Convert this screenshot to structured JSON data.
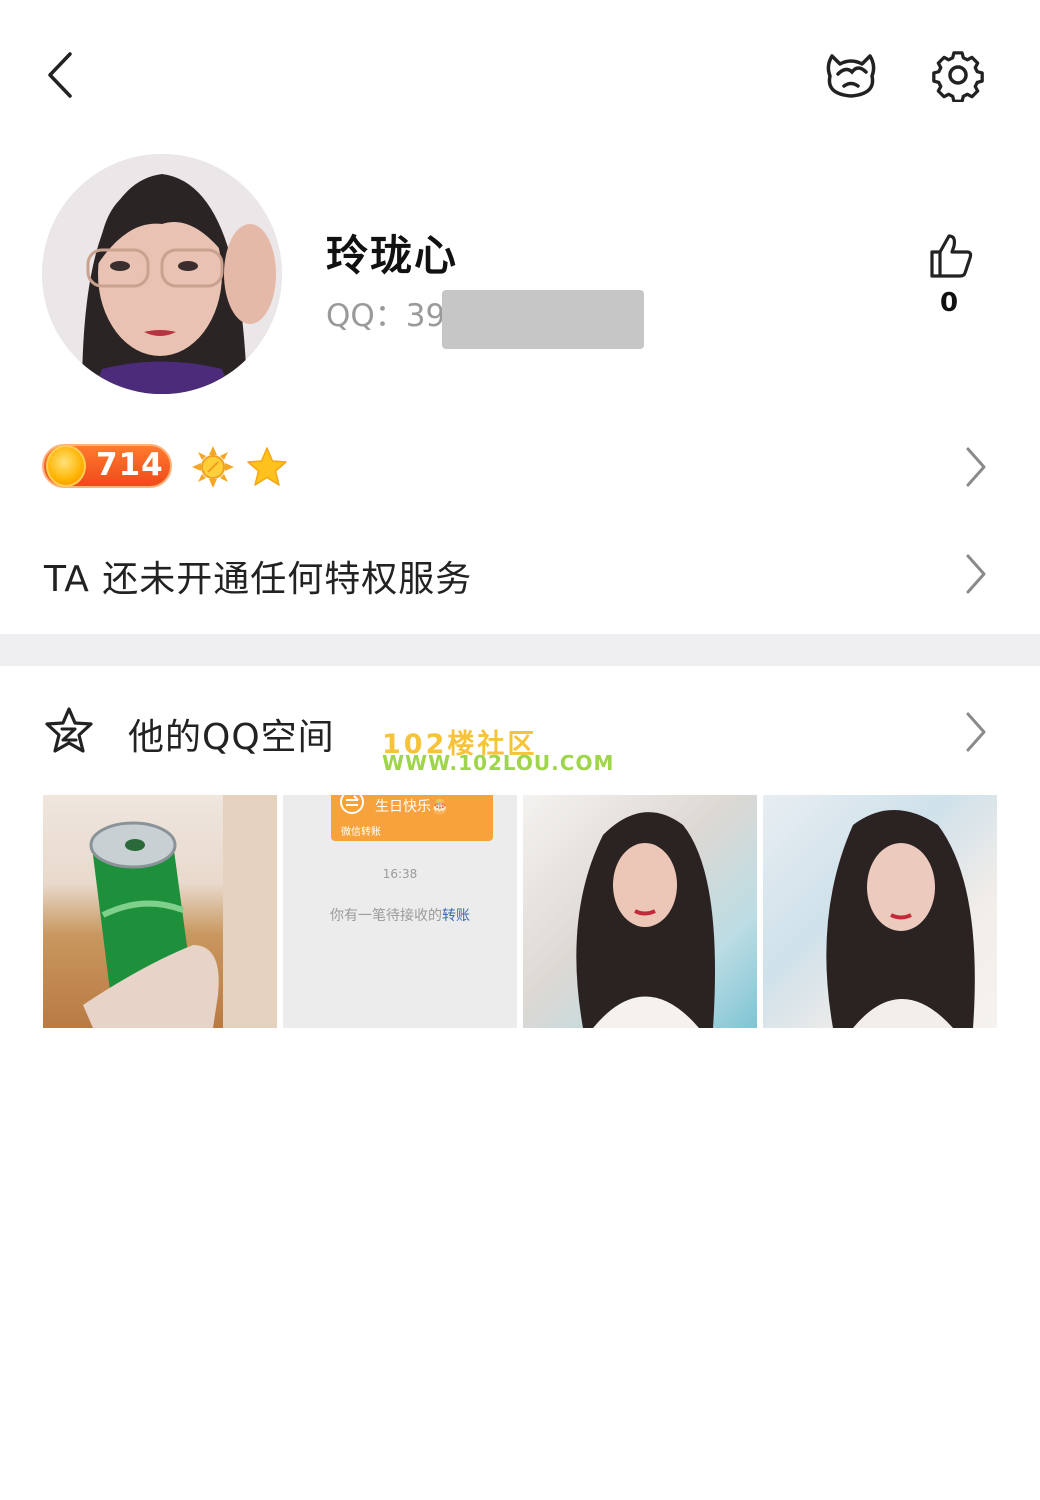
{
  "topbar": {
    "back_icon": "chevron-left-icon",
    "pet_icon": "pet-cat-icon",
    "settings_icon": "gear-icon"
  },
  "profile": {
    "nickname": "玲珑心",
    "qq_label": "QQ：39",
    "likes": "0"
  },
  "level": {
    "value": "714",
    "badges": [
      "sun-icon",
      "star-icon"
    ]
  },
  "privilege": {
    "text": "TA 还未开通任何特权服务"
  },
  "qzone": {
    "title": "他的QQ空间"
  },
  "watermark": {
    "line1": "102楼社区",
    "line2": "WWW.102LOU.COM"
  },
  "photos": {
    "chat": {
      "bubble_title": "生日快乐🎂",
      "bubble_sub": "微信转账",
      "time": "16:38",
      "message": "你有一笔待接收的",
      "link": "转账"
    }
  },
  "colors": {
    "accent_orange": "#f7a23b",
    "level_red": "#ef4a1b",
    "divider": "#efeff1",
    "link": "#3b6ab5"
  }
}
